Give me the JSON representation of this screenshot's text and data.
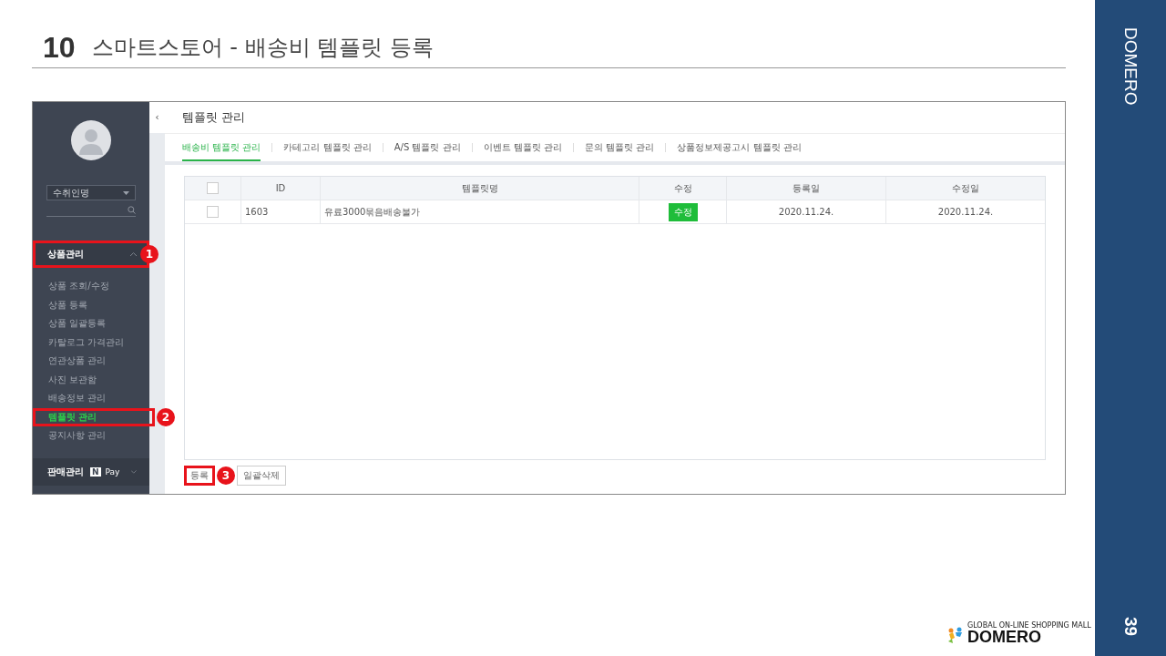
{
  "slide": {
    "number": "10",
    "title": "스마트스토어 - 배송비 템플릿 등록",
    "brand": "DOMERO",
    "page": "39",
    "logo": {
      "tagline": "GLOBAL ON-LINE SHOPPING MALL",
      "name": "DOMERO"
    }
  },
  "sidebar": {
    "select": {
      "value": "수취인명"
    },
    "sections": [
      {
        "label": "상품관리",
        "expanded": true,
        "callout": "1",
        "items": [
          {
            "label": "상품 조회/수정",
            "selected": false
          },
          {
            "label": "상품 등록",
            "selected": false
          },
          {
            "label": "상품 일괄등록",
            "selected": false
          },
          {
            "label": "카탈로그 가격관리",
            "selected": false
          },
          {
            "label": "연관상품 관리",
            "selected": false
          },
          {
            "label": "사진 보관함",
            "selected": false
          },
          {
            "label": "배송정보 관리",
            "selected": false
          },
          {
            "label": "템플릿 관리",
            "selected": true,
            "callout": "2"
          },
          {
            "label": "공지사항 관리",
            "selected": false
          }
        ]
      },
      {
        "label": "판매관리",
        "expanded": false,
        "badge": "N",
        "badge_text": "Pay"
      }
    ]
  },
  "collapse_button": "‹",
  "page_title": "템플릿 관리",
  "tabs": [
    {
      "label": "배송비 템플릿 관리",
      "selected": true
    },
    {
      "label": "카테고리 템플릿 관리",
      "selected": false
    },
    {
      "label": "A/S 템플릿 관리",
      "selected": false
    },
    {
      "label": "이벤트 템플릿 관리",
      "selected": false
    },
    {
      "label": "문의 템플릿 관리",
      "selected": false
    },
    {
      "label": "상품정보제공고시 템플릿 관리",
      "selected": false
    }
  ],
  "table": {
    "header_checked": false,
    "columns": [
      "ID",
      "템플릿명",
      "수정",
      "등록일",
      "수정일"
    ],
    "rows": [
      {
        "checked": false,
        "id": "1603",
        "name": "유료3000묶음배송불가",
        "edit": "수정",
        "created": "2020.11.24.",
        "modified": "2020.11.24."
      }
    ]
  },
  "buttons": [
    {
      "label": "등록",
      "callout": "3"
    },
    {
      "label": "일괄삭제"
    }
  ]
}
